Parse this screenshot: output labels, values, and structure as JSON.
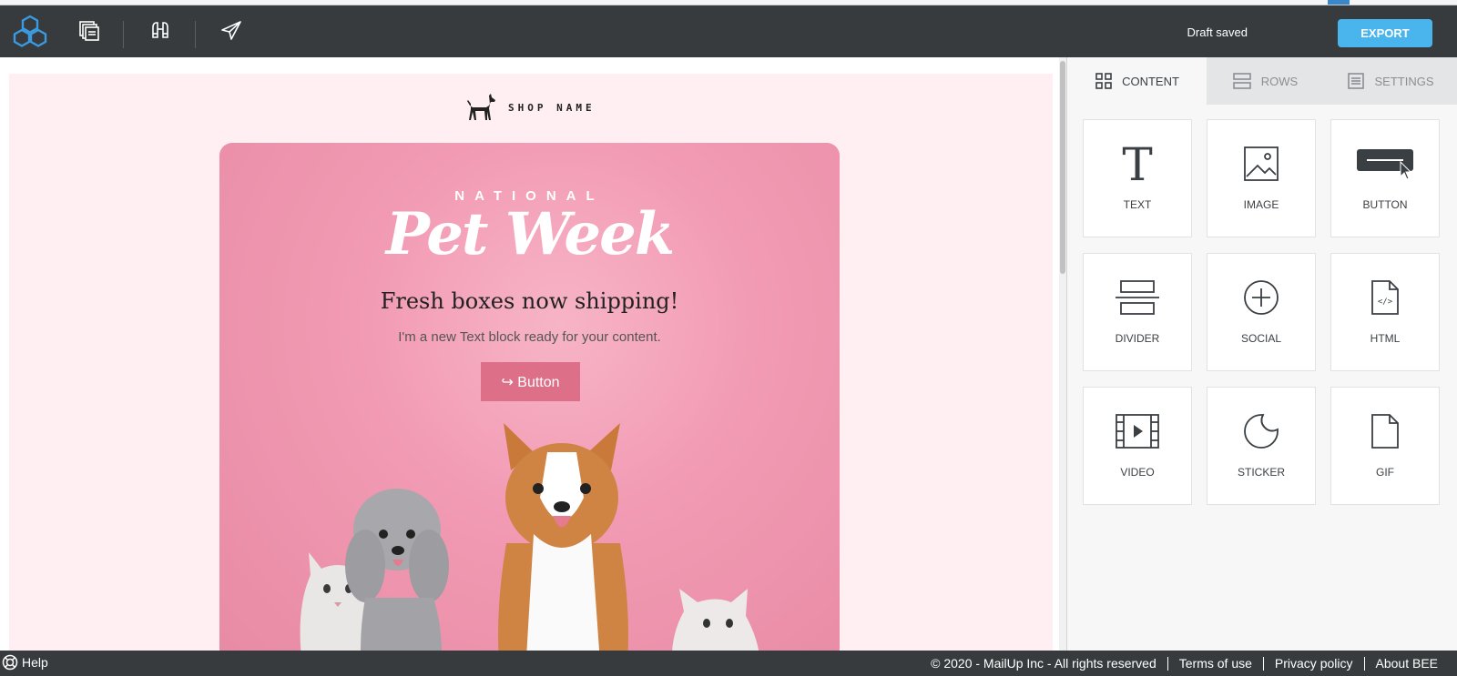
{
  "toolbar": {
    "draft_status": "Draft saved",
    "export_label": "EXPORT",
    "icons": [
      "logo-cubes",
      "pages-icon",
      "preview-binoculars-icon",
      "send-test-icon"
    ],
    "accent_color": "#4ab5ec"
  },
  "email": {
    "shop_name": "SHOP NAME",
    "hero_kicker": "NATIONAL",
    "hero_title": "Pet Week",
    "headline": "Fresh boxes now shipping!",
    "body_text": "I'm a new Text block ready for your content.",
    "button_label": "↪ Button",
    "background_color": "#ffeff2"
  },
  "panel": {
    "tabs": [
      {
        "label": "CONTENT",
        "icon": "grid-icon",
        "active": true
      },
      {
        "label": "ROWS",
        "icon": "rows-icon",
        "active": false
      },
      {
        "label": "SETTINGS",
        "icon": "settings-list-icon",
        "active": false
      }
    ],
    "blocks": [
      {
        "label": "TEXT",
        "icon": "text-icon"
      },
      {
        "label": "IMAGE",
        "icon": "image-icon"
      },
      {
        "label": "BUTTON",
        "icon": "button-icon"
      },
      {
        "label": "DIVIDER",
        "icon": "divider-icon"
      },
      {
        "label": "SOCIAL",
        "icon": "social-plus-icon"
      },
      {
        "label": "HTML",
        "icon": "html-file-icon"
      },
      {
        "label": "VIDEO",
        "icon": "video-icon"
      },
      {
        "label": "STICKER",
        "icon": "sticker-icon"
      },
      {
        "label": "GIF",
        "icon": "gif-file-icon"
      }
    ]
  },
  "footer": {
    "help_label": "Help",
    "copyright": "© 2020 - MailUp Inc - All rights reserved",
    "terms": "Terms of use",
    "privacy": "Privacy policy",
    "about": "About BEE"
  }
}
